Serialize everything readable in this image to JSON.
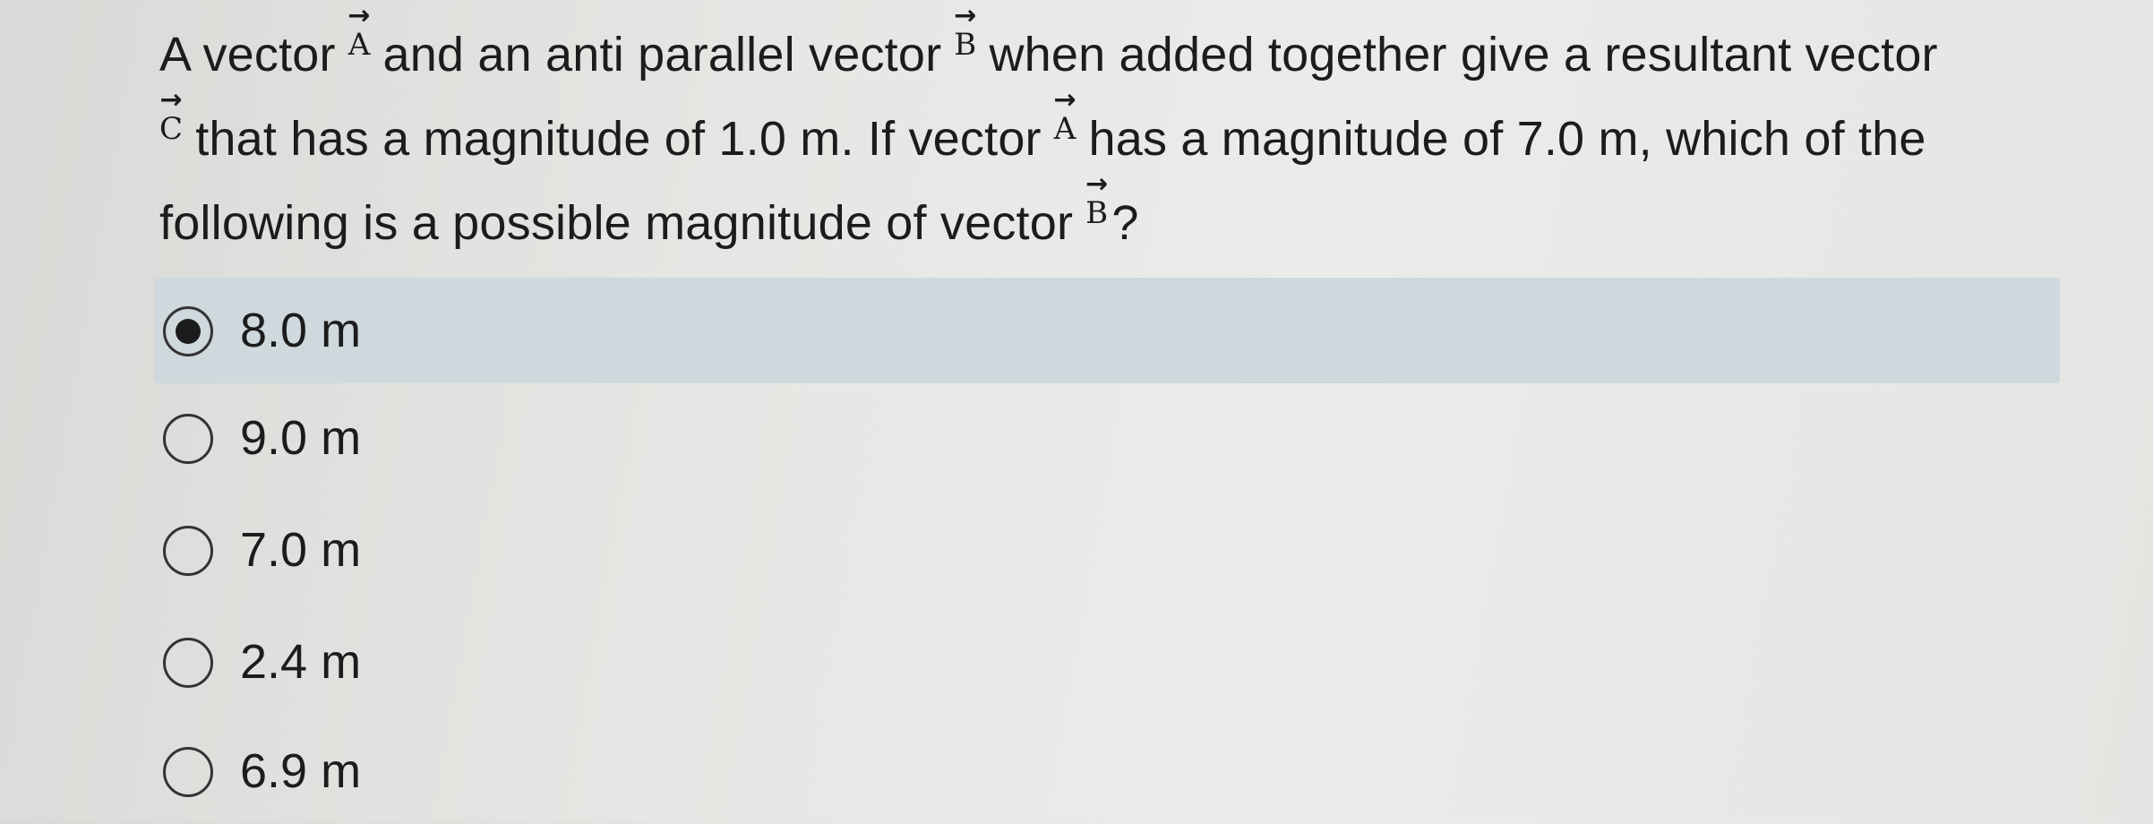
{
  "question": {
    "part1": "A vector",
    "vecA": "A",
    "part2": "and an anti parallel vector",
    "vecB": "B",
    "part3": "when added together give a resultant vector",
    "vecC": "C",
    "part4": "that has a magnitude of 1.0 m. If vector",
    "vecA2": "A",
    "part5": "has a magnitude of 7.0 m, which of the following is a possible magnitude of vector",
    "vecB2": "B",
    "part6": "?"
  },
  "options": [
    {
      "label": "8.0 m",
      "selected": true
    },
    {
      "label": "9.0 m",
      "selected": false
    },
    {
      "label": "7.0 m",
      "selected": false
    },
    {
      "label": "2.4 m",
      "selected": false
    },
    {
      "label": "6.9 m",
      "selected": false
    }
  ],
  "colors": {
    "selected_highlight": "#cfd8dc",
    "text": "#1c1c1c"
  }
}
